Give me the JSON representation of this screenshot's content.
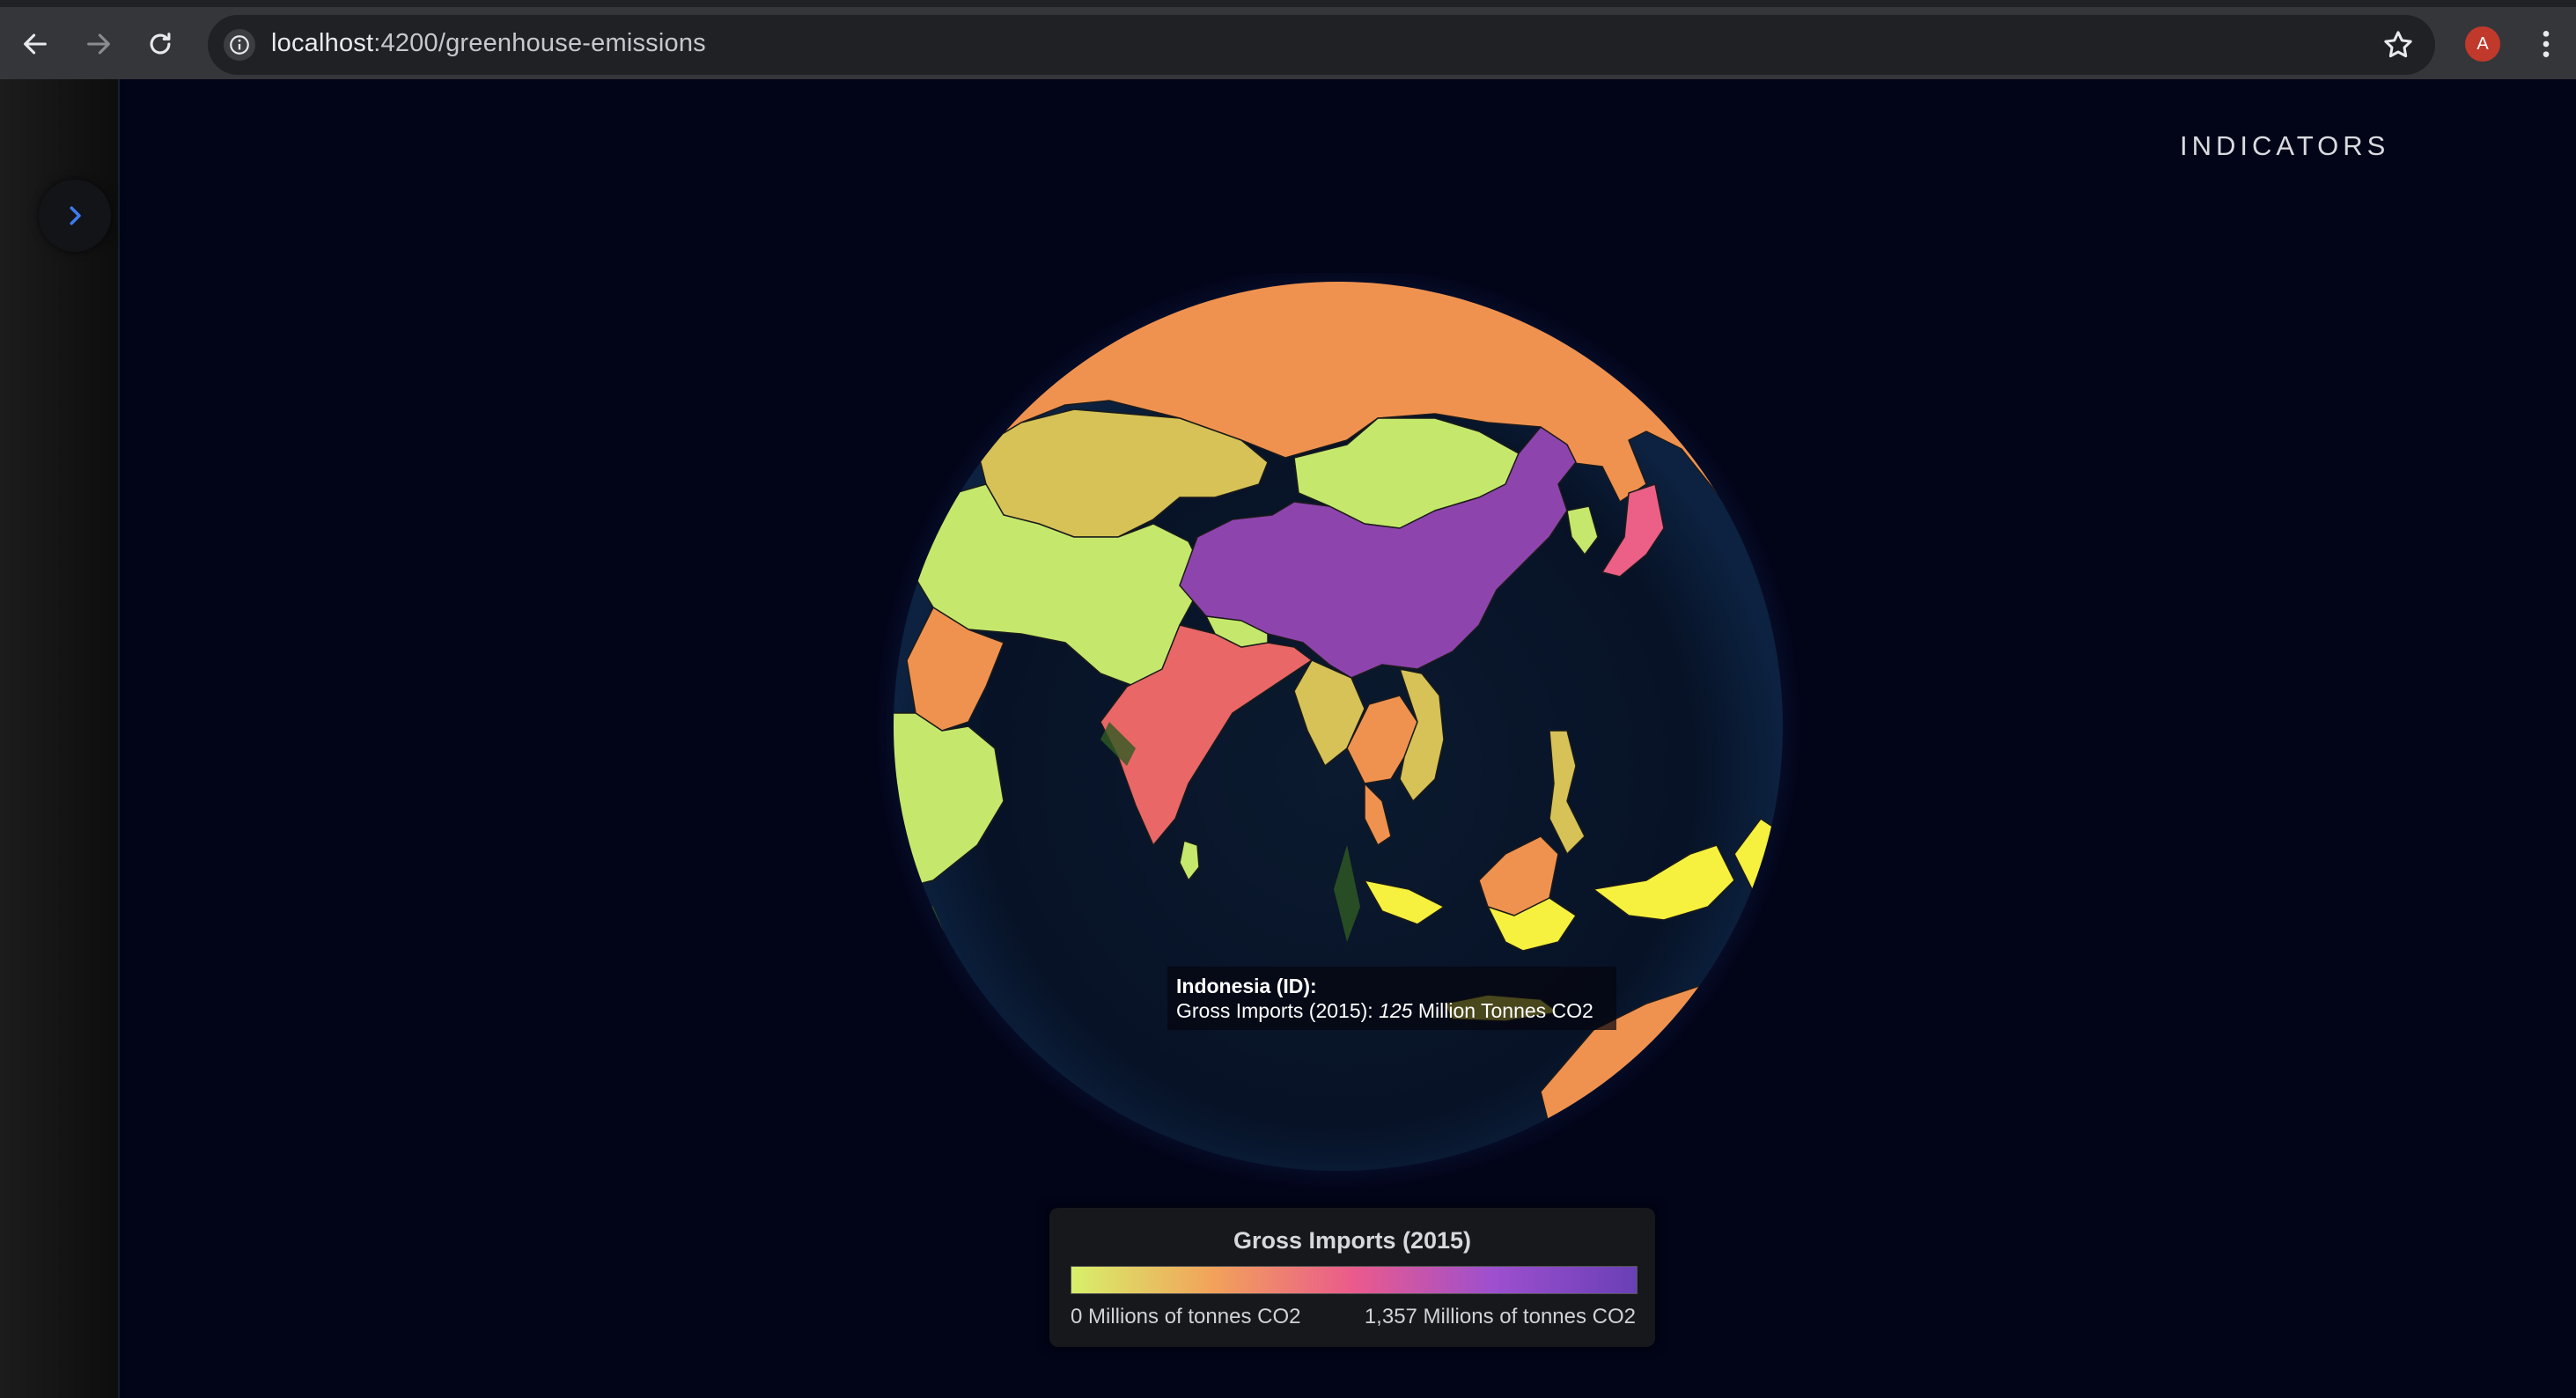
{
  "browser": {
    "url_host": "localhost",
    "url_path": ":4200/greenhouse-emissions",
    "avatar_letter": "A"
  },
  "app": {
    "indicators_label": "INDICATORS"
  },
  "tooltip": {
    "country": "Indonesia (ID):",
    "metric_prefix": "Gross Imports (2015): ",
    "value": "125",
    "unit_suffix": " Million Tonnes CO2"
  },
  "legend": {
    "title": "Gross Imports (2015)",
    "min_label": "0 Millions of tonnes CO2",
    "max_label": "1,357 Millions of tonnes CO2",
    "color_scale": [
      "#d7f06a",
      "#f2a25a",
      "#ea5a8c",
      "#9c4fcf",
      "#6a3fb6"
    ]
  },
  "colors": {
    "page_background": "#020418",
    "ocean": "#071226",
    "china": "#8e44ad",
    "india": "#ea6767",
    "russia": "#f0924f",
    "indonesia": "#f6f13e",
    "mongolia": "#c5e86c",
    "kazakhstan": "#d6c256",
    "japan": "#ec5f86"
  }
}
